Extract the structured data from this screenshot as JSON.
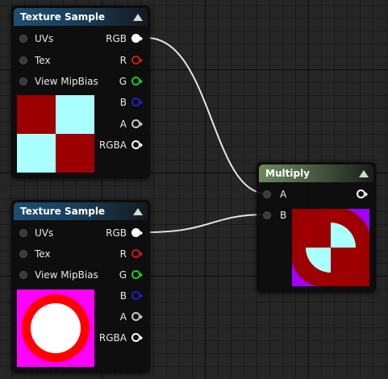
{
  "colors": {
    "texture_header": "#1d4f70",
    "multiply_header": "#6b8a5c",
    "pin_rgb": "#ffffff",
    "pin_r": "#cc1a1a",
    "pin_g": "#22c922",
    "pin_b": "#2020c0",
    "pin_a": "#c8c8c8",
    "pin_rgba": "#ffffff",
    "wire": "#e6e6e6",
    "checker_red": "#9c0000",
    "checker_cyan": "#aaffff",
    "disc_magenta": "#ff00ff",
    "disc_red": "#ff0000",
    "disc_white": "#ffffff",
    "multiply_purple": "#a000ff"
  },
  "nodes": {
    "texture_sample_1": {
      "title": "Texture Sample",
      "inputs": [
        "UVs",
        "Tex",
        "View MipBias"
      ],
      "outputs": [
        "RGB",
        "R",
        "G",
        "B",
        "A",
        "RGBA"
      ],
      "preview_icon": "checker-texture-preview"
    },
    "texture_sample_2": {
      "title": "Texture Sample",
      "inputs": [
        "UVs",
        "Tex",
        "View MipBias"
      ],
      "outputs": [
        "RGB",
        "R",
        "G",
        "B",
        "A",
        "RGBA"
      ],
      "preview_icon": "circle-texture-preview"
    },
    "multiply": {
      "title": "Multiply",
      "inputs": [
        "A",
        "B"
      ],
      "preview_icon": "multiply-result-preview"
    }
  },
  "connections": [
    {
      "from": "texture_sample_1.RGB",
      "to": "multiply.A"
    },
    {
      "from": "texture_sample_2.RGB",
      "to": "multiply.B"
    }
  ]
}
